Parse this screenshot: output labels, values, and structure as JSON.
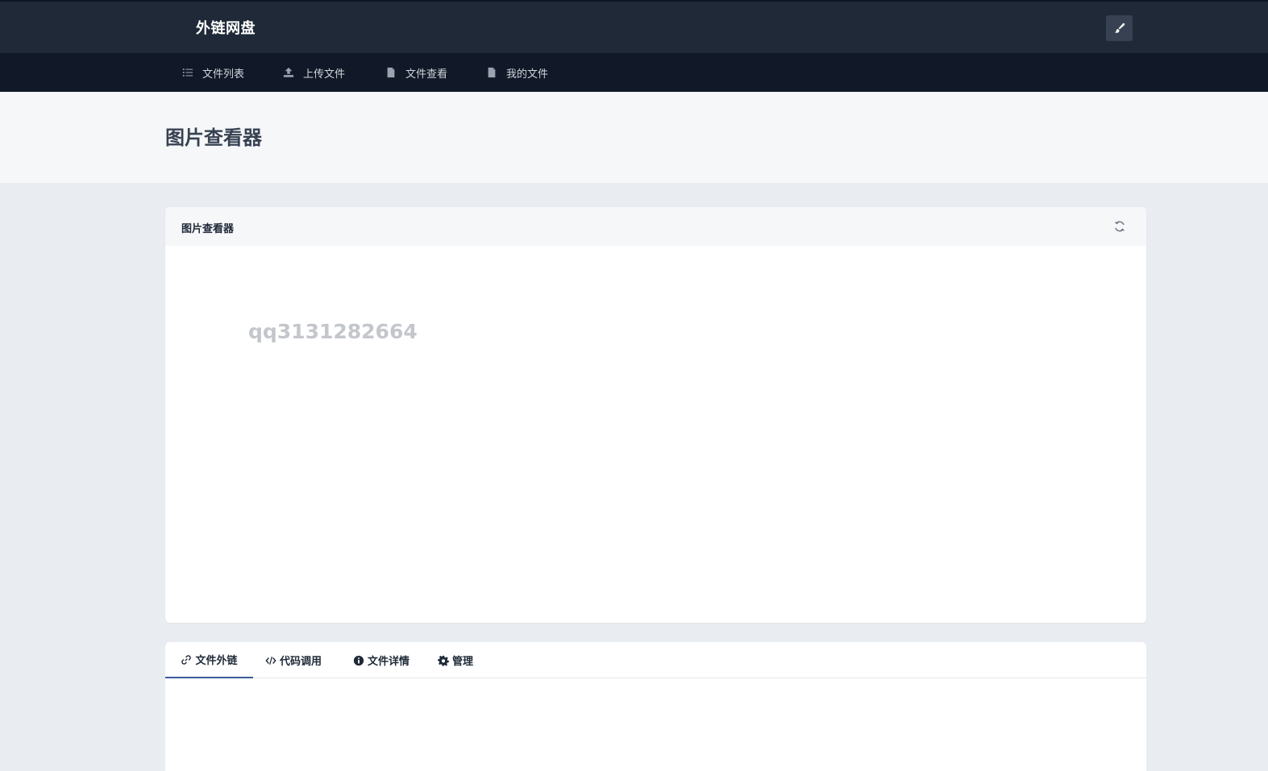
{
  "topbar": {
    "brand": "外链网盘",
    "theme_button_icon": "brush-icon"
  },
  "nav": {
    "items": [
      {
        "label": "文件列表",
        "icon": "list-icon"
      },
      {
        "label": "上传文件",
        "icon": "upload-icon"
      },
      {
        "label": "文件查看",
        "icon": "file-icon"
      },
      {
        "label": "我的文件",
        "icon": "file-icon"
      }
    ]
  },
  "page": {
    "title": "图片查看器"
  },
  "viewer": {
    "title": "图片查看器",
    "refresh_icon": "refresh-icon",
    "watermark": "qq3131282664"
  },
  "tabs": {
    "items": [
      {
        "label": "文件外链",
        "icon": "link-icon",
        "active": true
      },
      {
        "label": "代码调用",
        "icon": "code-icon",
        "active": false
      },
      {
        "label": "文件详情",
        "icon": "info-icon",
        "active": false
      },
      {
        "label": "管理",
        "icon": "gear-icon",
        "active": false
      }
    ]
  },
  "colors": {
    "topbar": "#1f2937",
    "navbar": "#111827",
    "page_bg": "#e9ecf1",
    "active_tab": "#3b5a99"
  }
}
